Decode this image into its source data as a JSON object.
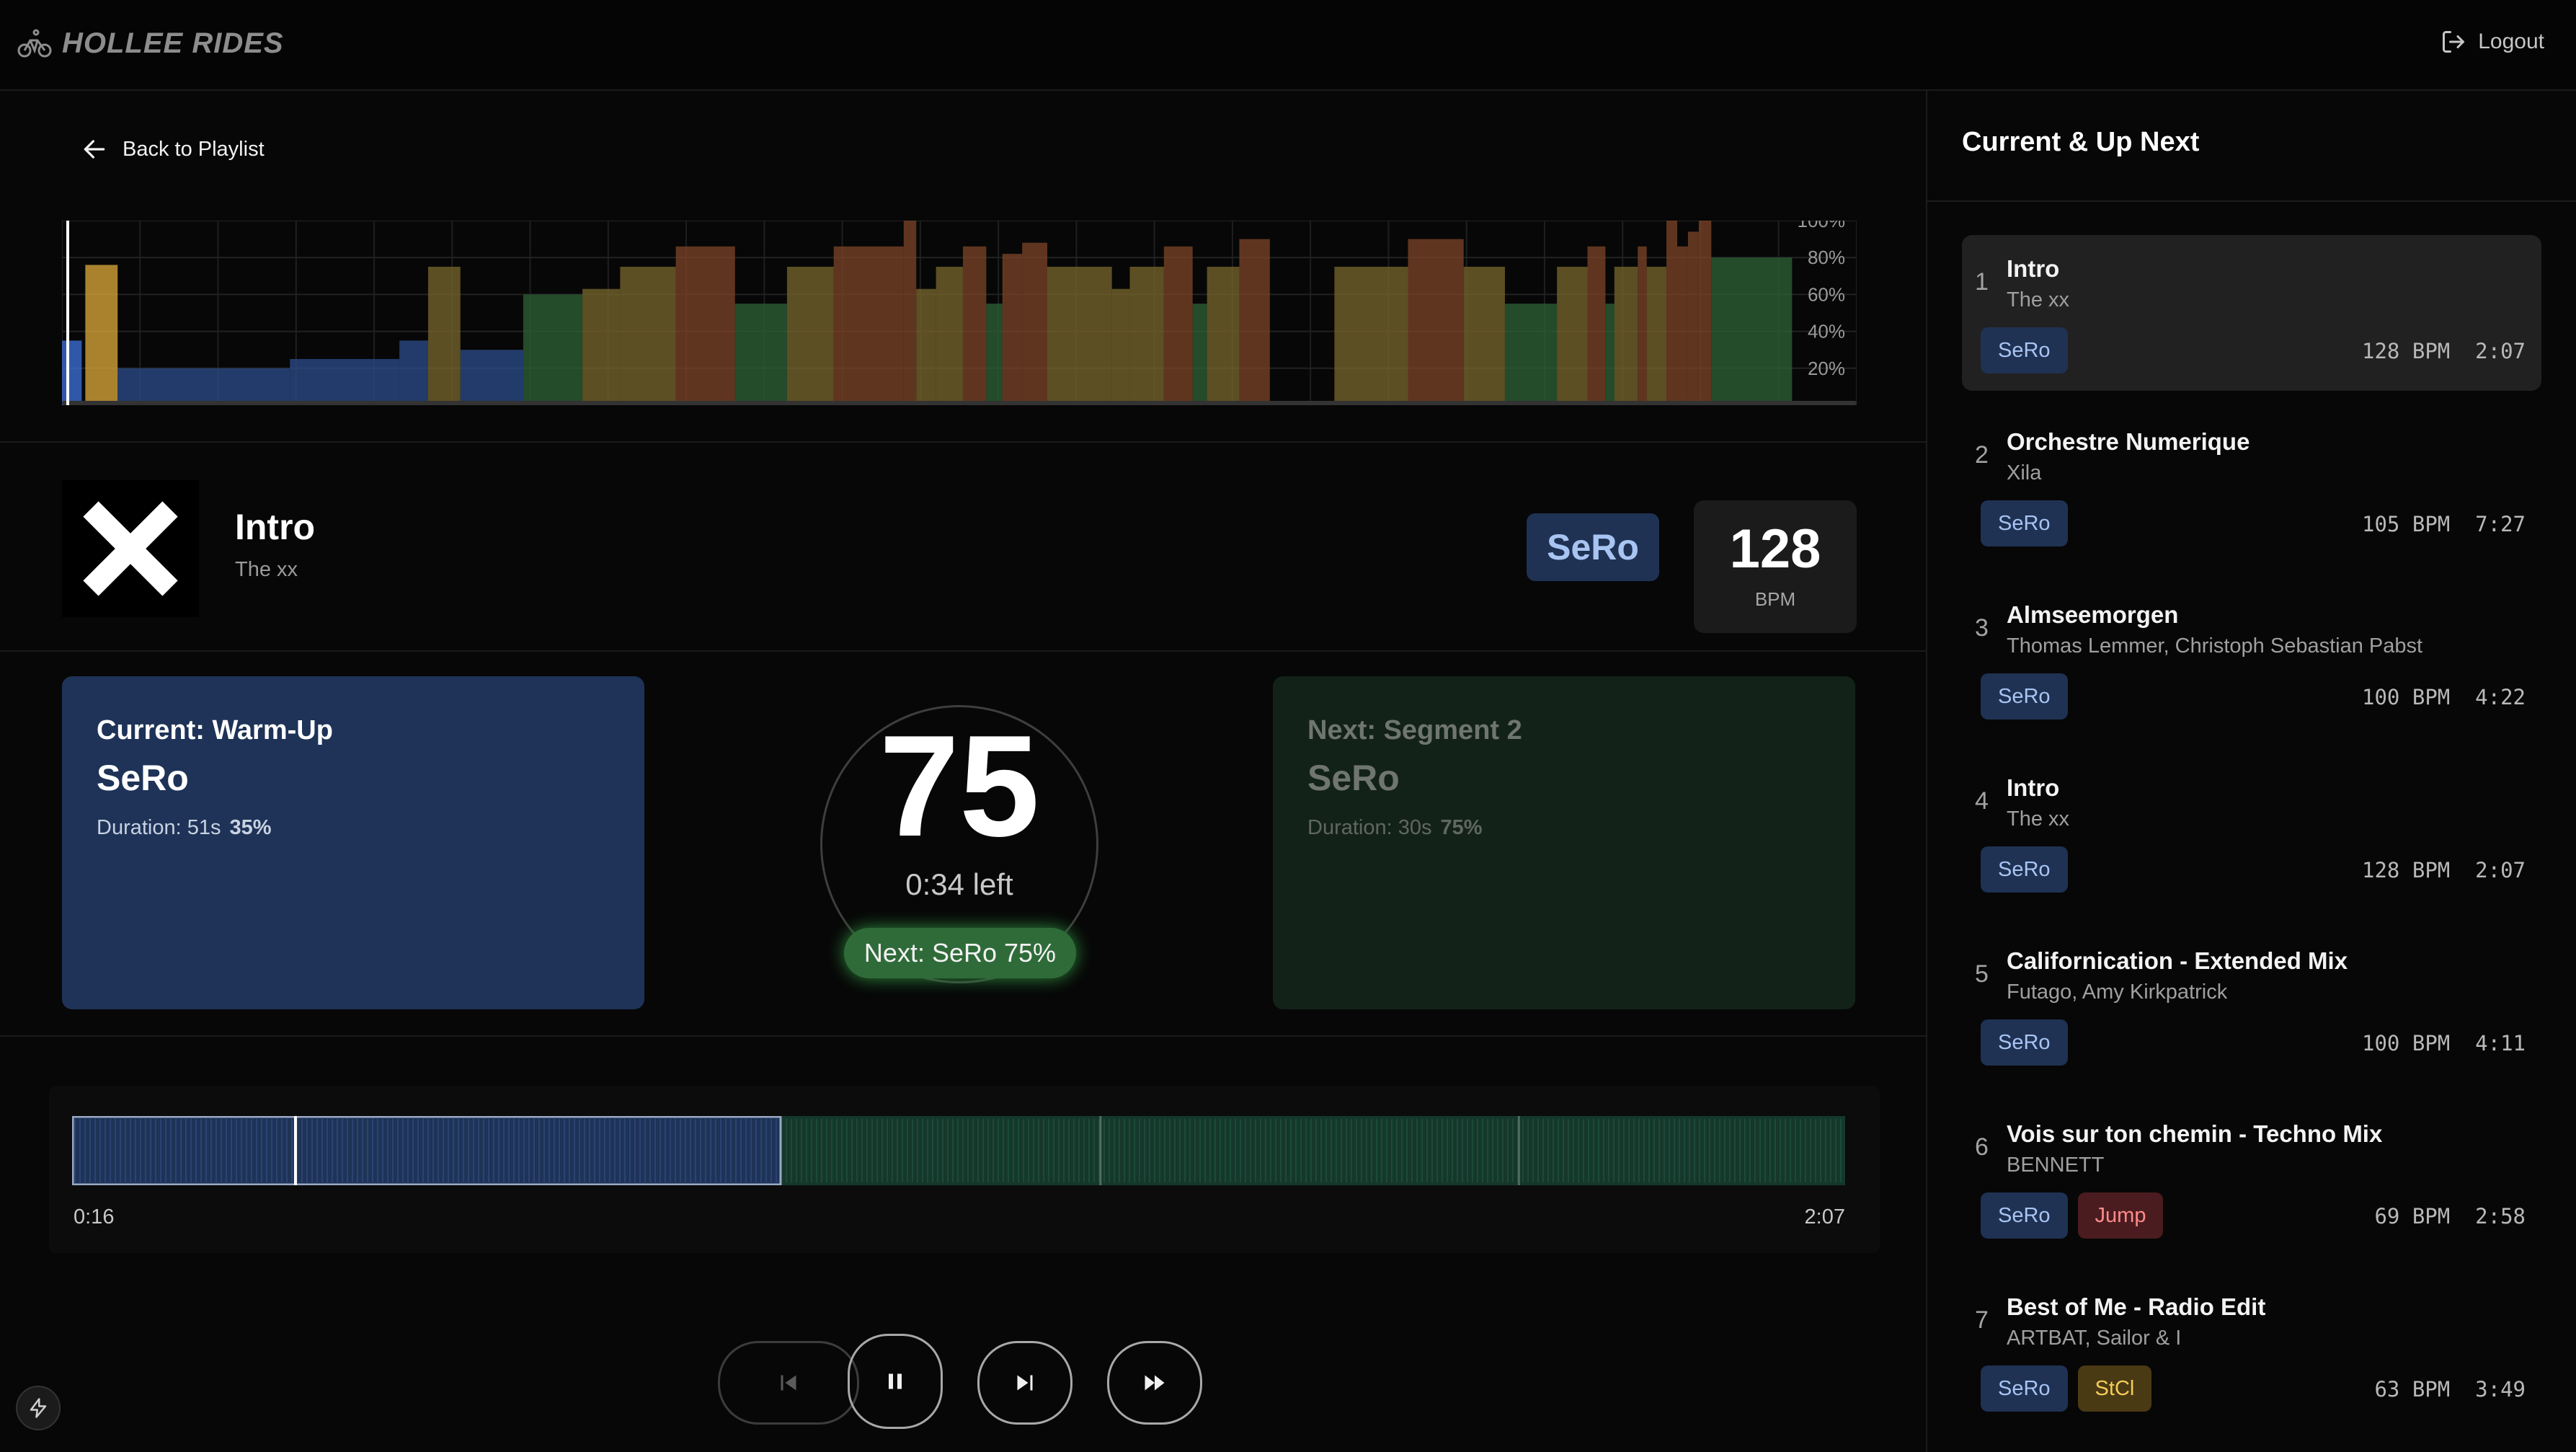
{
  "app": {
    "brand": "HOLLEE RIDES",
    "logout_label": "Logout"
  },
  "nav": {
    "back_label": "Back to Playlist"
  },
  "chart_data": {
    "type": "bar",
    "y_ticks": [
      "100%",
      "80%",
      "60%",
      "40%",
      "20%"
    ],
    "ylim": [
      0,
      100
    ],
    "bars": [
      {
        "x": 0,
        "w": 1.1,
        "v": 35,
        "c": "#3d6fd6"
      },
      {
        "x": 1.3,
        "w": 1.8,
        "v": 76,
        "c": "#d8a53a"
      },
      {
        "x": 3.1,
        "w": 9.6,
        "v": 20,
        "c": "#2b4a86"
      },
      {
        "x": 12.7,
        "w": 6.1,
        "v": 25,
        "c": "#2b4a86"
      },
      {
        "x": 18.8,
        "w": 1.6,
        "v": 35,
        "c": "#2b4a86"
      },
      {
        "x": 20.4,
        "w": 1.8,
        "v": 75,
        "c": "#75642c"
      },
      {
        "x": 22.2,
        "w": 3.5,
        "v": 30,
        "c": "#2b4a86"
      },
      {
        "x": 25.7,
        "w": 3.3,
        "v": 60,
        "c": "#2d5f35"
      },
      {
        "x": 29.0,
        "w": 2.1,
        "v": 63,
        "c": "#75642c"
      },
      {
        "x": 31.1,
        "w": 3.1,
        "v": 75,
        "c": "#75642c"
      },
      {
        "x": 34.2,
        "w": 3.3,
        "v": 86,
        "c": "#7a4326"
      },
      {
        "x": 37.5,
        "w": 2.9,
        "v": 55,
        "c": "#2d5f35"
      },
      {
        "x": 40.4,
        "w": 2.6,
        "v": 75,
        "c": "#75642c"
      },
      {
        "x": 43.0,
        "w": 3.9,
        "v": 86,
        "c": "#7a4326"
      },
      {
        "x": 46.9,
        "w": 0.7,
        "v": 100,
        "c": "#7a4326"
      },
      {
        "x": 47.6,
        "w": 1.1,
        "v": 63,
        "c": "#75642c"
      },
      {
        "x": 48.7,
        "w": 1.5,
        "v": 75,
        "c": "#75642c"
      },
      {
        "x": 50.2,
        "w": 1.3,
        "v": 86,
        "c": "#7a4326"
      },
      {
        "x": 51.5,
        "w": 0.9,
        "v": 55,
        "c": "#2d5f35"
      },
      {
        "x": 52.4,
        "w": 1.1,
        "v": 82,
        "c": "#7a4326"
      },
      {
        "x": 53.5,
        "w": 1.4,
        "v": 88,
        "c": "#7a4326"
      },
      {
        "x": 54.9,
        "w": 3.6,
        "v": 75,
        "c": "#75642c"
      },
      {
        "x": 58.5,
        "w": 1.0,
        "v": 63,
        "c": "#75642c"
      },
      {
        "x": 59.5,
        "w": 1.9,
        "v": 75,
        "c": "#75642c"
      },
      {
        "x": 61.4,
        "w": 1.6,
        "v": 86,
        "c": "#7a4326"
      },
      {
        "x": 63.0,
        "w": 0.8,
        "v": 55,
        "c": "#2d5f35"
      },
      {
        "x": 63.8,
        "w": 1.8,
        "v": 75,
        "c": "#75642c"
      },
      {
        "x": 65.6,
        "w": 1.7,
        "v": 90,
        "c": "#7a4326"
      },
      {
        "x": 67.3,
        "w": 3.6,
        "v": 0,
        "c": "#2b4a86"
      },
      {
        "x": 70.9,
        "w": 4.1,
        "v": 75,
        "c": "#75642c"
      },
      {
        "x": 75.0,
        "w": 3.1,
        "v": 90,
        "c": "#7a4326"
      },
      {
        "x": 78.1,
        "w": 2.3,
        "v": 75,
        "c": "#75642c"
      },
      {
        "x": 80.4,
        "w": 2.9,
        "v": 55,
        "c": "#2d5f35"
      },
      {
        "x": 83.3,
        "w": 1.7,
        "v": 75,
        "c": "#75642c"
      },
      {
        "x": 85.0,
        "w": 1.0,
        "v": 86,
        "c": "#7a4326"
      },
      {
        "x": 86.0,
        "w": 0.5,
        "v": 55,
        "c": "#2d5f35"
      },
      {
        "x": 86.5,
        "w": 1.3,
        "v": 75,
        "c": "#75642c"
      },
      {
        "x": 87.8,
        "w": 0.5,
        "v": 86,
        "c": "#7a4326"
      },
      {
        "x": 88.3,
        "w": 1.1,
        "v": 75,
        "c": "#75642c"
      },
      {
        "x": 89.4,
        "w": 0.6,
        "v": 100,
        "c": "#7a4326"
      },
      {
        "x": 90.0,
        "w": 0.6,
        "v": 86,
        "c": "#7a4326"
      },
      {
        "x": 90.6,
        "w": 0.6,
        "v": 94,
        "c": "#7a4326"
      },
      {
        "x": 91.2,
        "w": 0.7,
        "v": 100,
        "c": "#7a4326"
      },
      {
        "x": 91.9,
        "w": 4.5,
        "v": 80,
        "c": "#2d5f35"
      },
      {
        "x": 96.4,
        "w": 3.6,
        "v": 0,
        "c": "#2b4a86"
      }
    ]
  },
  "now_playing": {
    "title": "Intro",
    "artist": "The xx",
    "zone": "SeRo",
    "bpm": "128",
    "bpm_label": "BPM"
  },
  "current_segment": {
    "title": "Current: Warm-Up",
    "zone": "SeRo",
    "duration_label": "Duration: 51s",
    "intensity": "35%"
  },
  "next_segment": {
    "title": "Next: Segment 2",
    "zone": "SeRo",
    "duration_label": "Duration: 30s",
    "intensity": "75%"
  },
  "timer": {
    "value": "75",
    "remaining": "0:34 left",
    "next_pill": "Next: SeRo 75%"
  },
  "scrubber": {
    "elapsed": "0:16",
    "total": "2:07",
    "segments": [
      {
        "label": "Warm-Up",
        "end_fraction": 0.4,
        "color": "#1e3357"
      },
      {
        "label": "Segment 2",
        "end_fraction": 1.0,
        "color": "#15382b"
      }
    ],
    "progress_fraction": 0.126
  },
  "sidebar": {
    "title": "Current & Up Next",
    "queue": [
      {
        "num": "1",
        "title": "Intro",
        "artist": "The xx",
        "tags": [
          {
            "label": "SeRo",
            "kind": "sero"
          }
        ],
        "bpm": "128 BPM",
        "duration": "2:07",
        "active": true
      },
      {
        "num": "2",
        "title": "Orchestre Numerique",
        "artist": "Xila",
        "tags": [
          {
            "label": "SeRo",
            "kind": "sero"
          }
        ],
        "bpm": "105 BPM",
        "duration": "7:27",
        "active": false
      },
      {
        "num": "3",
        "title": "Almseemorgen",
        "artist": "Thomas Lemmer, Christoph Sebastian Pabst",
        "tags": [
          {
            "label": "SeRo",
            "kind": "sero"
          }
        ],
        "bpm": "100 BPM",
        "duration": "4:22",
        "active": false
      },
      {
        "num": "4",
        "title": "Intro",
        "artist": "The xx",
        "tags": [
          {
            "label": "SeRo",
            "kind": "sero"
          }
        ],
        "bpm": "128 BPM",
        "duration": "2:07",
        "active": false
      },
      {
        "num": "5",
        "title": "Californication - Extended Mix",
        "artist": "Futago, Amy Kirkpatrick",
        "tags": [
          {
            "label": "SeRo",
            "kind": "sero"
          }
        ],
        "bpm": "100 BPM",
        "duration": "4:11",
        "active": false
      },
      {
        "num": "6",
        "title": "Vois sur ton chemin - Techno Mix",
        "artist": "BENNETT",
        "tags": [
          {
            "label": "SeRo",
            "kind": "sero"
          },
          {
            "label": "Jump",
            "kind": "jump"
          }
        ],
        "bpm": "69 BPM",
        "duration": "2:58",
        "active": false
      },
      {
        "num": "7",
        "title": "Best of Me - Radio Edit",
        "artist": "ARTBAT, Sailor & I",
        "tags": [
          {
            "label": "SeRo",
            "kind": "sero"
          },
          {
            "label": "StCl",
            "kind": "stcl"
          }
        ],
        "bpm": "63 BPM",
        "duration": "3:49",
        "active": false
      }
    ]
  },
  "icons": {
    "brand": "bicycle-icon",
    "logout": "logout-icon",
    "back": "arrow-left-icon",
    "album_art": "x-logo-icon",
    "previous": "skip-back-icon",
    "pause": "pause-icon",
    "next": "skip-forward-icon",
    "fast_forward": "fast-forward-icon",
    "dev_tools": "bolt-icon"
  }
}
